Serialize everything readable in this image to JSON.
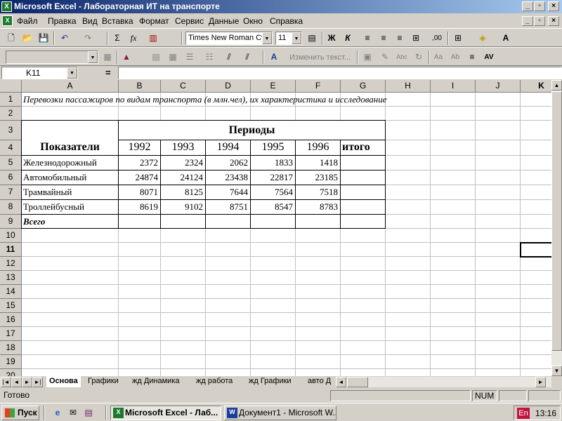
{
  "window": {
    "title": "Microsoft Excel - Лабораторная ИТ на транспорте",
    "app_icon": "X"
  },
  "menu": [
    "Файл",
    "Правка",
    "Вид",
    "Вставка",
    "Формат",
    "Сервис",
    "Данные",
    "Окно",
    "Справка"
  ],
  "toolbar1": {
    "font_name": "Times New Roman Cyr",
    "font_size": "11",
    "bold": "Ж",
    "italic": "К",
    "sigma": "Σ",
    "fx": "fx"
  },
  "toolbar2": {
    "edit_text": "Изменить текст..."
  },
  "formula_bar": {
    "name_box": "K11",
    "equals": "=",
    "content": ""
  },
  "columns": [
    "A",
    "B",
    "C",
    "D",
    "E",
    "F",
    "G",
    "H",
    "I",
    "J",
    "K"
  ],
  "rows": [
    "1",
    "2",
    "3",
    "4",
    "5",
    "6",
    "7",
    "8",
    "9",
    "10",
    "11",
    "12",
    "13",
    "14",
    "15",
    "16",
    "17",
    "18",
    "19",
    "20"
  ],
  "sheet": {
    "title_row": "Перевозки пассажиров по видам транспорта (в млн.чел), их характеристика и исследование",
    "header_periods": "Периоды",
    "header_indicators": "Показатели",
    "years": [
      "1992",
      "1993",
      "1994",
      "1995",
      "1996"
    ],
    "total_col": "итого",
    "data_rows": [
      {
        "label": "Железнодорожный",
        "values": [
          "2372",
          "2324",
          "2062",
          "1833",
          "1418"
        ]
      },
      {
        "label": "Автомобильный",
        "values": [
          "24874",
          "24124",
          "23438",
          "22817",
          "23185"
        ]
      },
      {
        "label": "Трамвайный",
        "values": [
          "8071",
          "8125",
          "7644",
          "7564",
          "7518"
        ]
      },
      {
        "label": "Троллейбусный",
        "values": [
          "8619",
          "9102",
          "8751",
          "8547",
          "8783"
        ]
      }
    ],
    "total_row": "Всего"
  },
  "sheet_tabs": [
    "Основа",
    "Графики",
    "жд Динамика",
    "жд работа",
    "жд Графики",
    "авто Д"
  ],
  "status": {
    "ready": "Готово",
    "num": "NUM"
  },
  "taskbar": {
    "start": "Пуск",
    "tasks": [
      "Microsoft Excel - Лаб...",
      "Документ1 - Microsoft W..."
    ],
    "lang": "En",
    "clock": "13:16"
  }
}
